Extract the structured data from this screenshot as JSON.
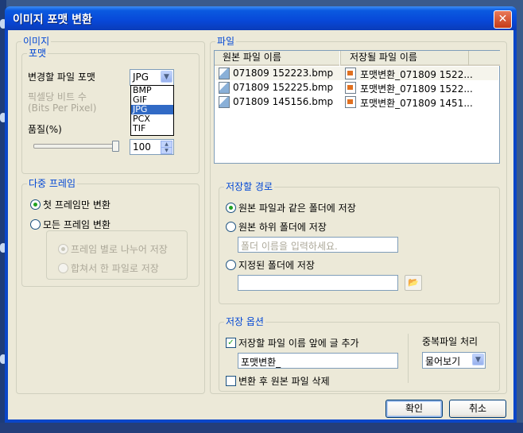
{
  "window": {
    "title": "이미지 포맷 변환",
    "close_glyph": "✕"
  },
  "image_group": {
    "legend": "이미지",
    "format_group": {
      "legend": "포맷",
      "target_label": "변경할 파일 포맷",
      "target_value": "JPG",
      "options": [
        "BMP",
        "GIF",
        "JPG",
        "PCX",
        "TIF"
      ],
      "selected_option": "JPG",
      "bpp_label": "픽셀당 비트 수",
      "bpp_sub": "(Bits Per Pixel)",
      "quality_label": "품질(%)",
      "quality_value": "100",
      "quality_percent": 100
    },
    "multiframe_group": {
      "legend": "다중 프레임",
      "first_frame": "첫 프레임만 변환",
      "all_frames": "모든 프레임 변환",
      "split_frames": "프레임 별로 나누어 저장",
      "merge_frames": "합쳐서 한 파일로 저장"
    }
  },
  "file_group": {
    "legend": "파일",
    "columns": [
      "원본 파일 이름",
      "저장될 파일 이름"
    ],
    "rows": [
      {
        "source": "071809 152223.bmp",
        "target": "포맷변환_071809 1522..."
      },
      {
        "source": "071809 152225.bmp",
        "target": "포맷변환_071809 1522..."
      },
      {
        "source": "071809 145156.bmp",
        "target": "포맷변환_071809 1451..."
      }
    ]
  },
  "save_path_group": {
    "legend": "저장할 경로",
    "same_folder": "원본 파일과 같은 폴더에 저장",
    "sub_folder": "원본 하위 폴더에 저장",
    "sub_folder_placeholder": "폴더 이름을 입력하세요.",
    "specified_folder": "지정된 폴더에 저장",
    "folder_path_value": ""
  },
  "save_options_group": {
    "legend": "저장 옵션",
    "prefix_checkbox": "저장할 파일 이름 앞에 글 추가",
    "prefix_value": "포맷변환_",
    "delete_checkbox": "변환 후 원본 파일 삭제",
    "duplicate_label": "중복파일 처리",
    "duplicate_value": "물어보기"
  },
  "buttons": {
    "ok": "확인",
    "cancel": "취소"
  }
}
